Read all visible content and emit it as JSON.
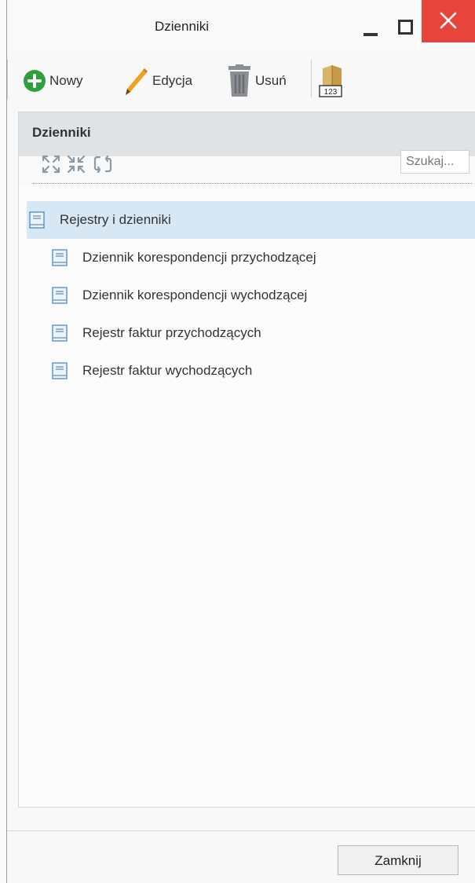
{
  "window": {
    "title": "Dzienniki"
  },
  "toolbar": {
    "new_label": "Nowy",
    "edit_label": "Edycja",
    "delete_label": "Usuń",
    "numbering_icon": "numbering-icon"
  },
  "panel": {
    "title": "Dzienniki",
    "search_placeholder": "Szukaj...",
    "tools": [
      "expand-all-icon",
      "collapse-all-icon",
      "refresh-icon"
    ]
  },
  "tree": {
    "root": {
      "label": "Rejestry i dzienniki"
    },
    "children": [
      {
        "label": "Dziennik korespondencji przychodzącej"
      },
      {
        "label": "Dziennik korespondencji wychodzącej"
      },
      {
        "label": "Rejestr faktur przychodzących"
      },
      {
        "label": "Rejestr faktur wychodzących"
      }
    ]
  },
  "footer": {
    "close_label": "Zamknij"
  },
  "colors": {
    "close_button_bg": "#e7443b",
    "selected_row_bg": "#d7e7f4",
    "new_icon": "#2f9e3e",
    "edit_icon": "#f0a21f"
  }
}
